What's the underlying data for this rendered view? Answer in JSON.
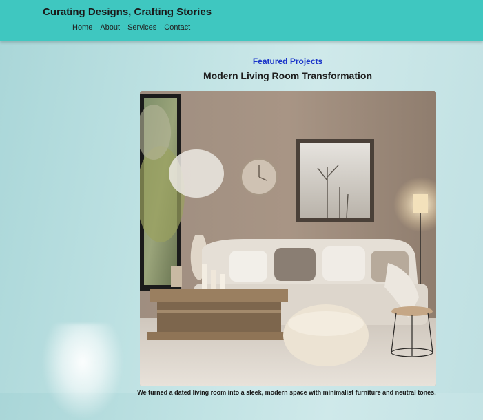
{
  "header": {
    "title": "Curating Designs, Crafting Stories",
    "nav": [
      "Home",
      "About",
      "Services",
      "Contact"
    ]
  },
  "featured": {
    "link_label": "Featured Projects",
    "project_title": "Modern Living Room Transformation",
    "caption": "We turned a dated living room into a sleek, modern space with minimalist furniture and neutral tones."
  },
  "colors": {
    "header_bg": "#3fc7c0",
    "link": "#1a35c9",
    "page_bg": "#bfe2e3"
  }
}
